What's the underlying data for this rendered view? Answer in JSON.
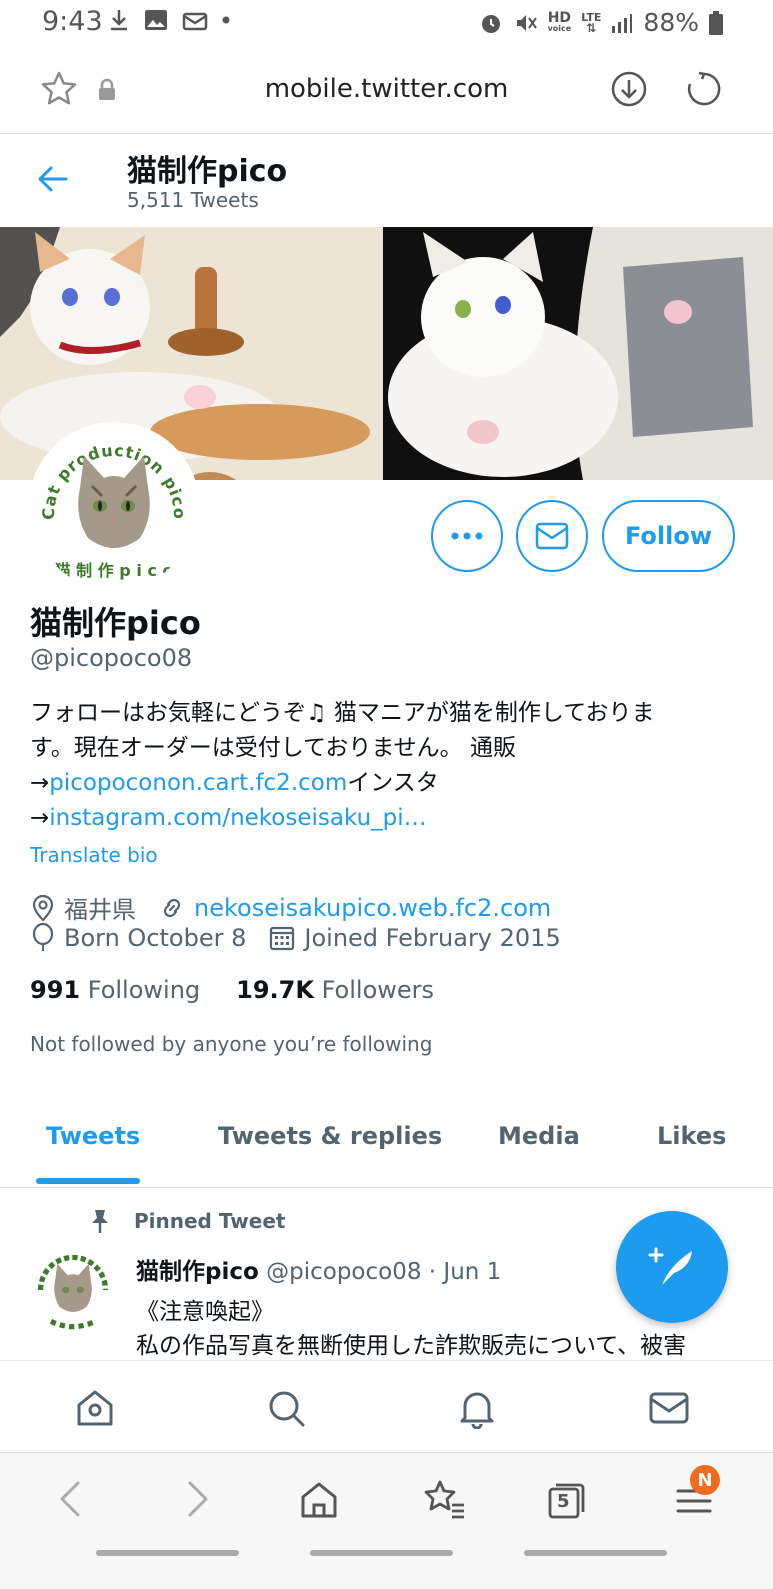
{
  "status_bar": {
    "time": "9:43",
    "network_hd": "HD",
    "network_voice": "voice",
    "network_lte": "LTE",
    "battery": "88%"
  },
  "browser": {
    "url": "mobile.twitter.com",
    "tab_count": "5",
    "notification_badge": "N"
  },
  "profile_header": {
    "name": "猫制作pico",
    "tweet_count": "5,511 Tweets"
  },
  "profile": {
    "display_name": "猫制作pico",
    "handle": "@picopoco08",
    "follow_label": "Follow",
    "bio": {
      "line1": "フォローはお気軽にどうぞ♫ 猫マニアが猫を制作しておりま",
      "line2": "す。現在オーダーは受付しておりません。 通販",
      "line3_arrow": "→",
      "line3_link": "picopoconon.cart.fc2.com",
      "line3_text": "インスタ",
      "line4_arrow": "→",
      "line4_link": "instagram.com/nekoseisaku_pi…"
    },
    "translate_label": "Translate bio",
    "location": "福井県",
    "website": "nekoseisakupico.web.fc2.com",
    "birthday": "Born October 8",
    "joined": "Joined February 2015",
    "following_count": "991",
    "following_label": "Following",
    "followers_count": "19.7K",
    "followers_label": "Followers",
    "not_followed": "Not followed by anyone you’re following",
    "avatar_text_top": "Cat production pico",
    "avatar_text_bottom": "猫 制 作 p i c o"
  },
  "tabs": [
    {
      "label": "Tweets",
      "active": true
    },
    {
      "label": "Tweets & replies",
      "active": false
    },
    {
      "label": "Media",
      "active": false
    },
    {
      "label": "Likes",
      "active": false
    }
  ],
  "pinned_tweet": {
    "pinned_label": "Pinned Tweet",
    "author_name": "猫制作pico",
    "author_meta": "@picopoco08 · Jun 1",
    "line1": "《注意喚起》",
    "line2": "私の作品写真を無断使用した詐欺販売について、被害"
  },
  "colors": {
    "accent": "#1d9bf0",
    "secondary_text": "#536471",
    "badge": "#f26b1d"
  },
  "icons": {
    "twitter_nav": [
      "home-icon",
      "search-icon",
      "notifications-icon",
      "messages-icon"
    ],
    "browser_nav": [
      "back-icon",
      "forward-icon",
      "home-icon",
      "bookmarks-icon",
      "tabs-icon",
      "menu-icon"
    ]
  }
}
